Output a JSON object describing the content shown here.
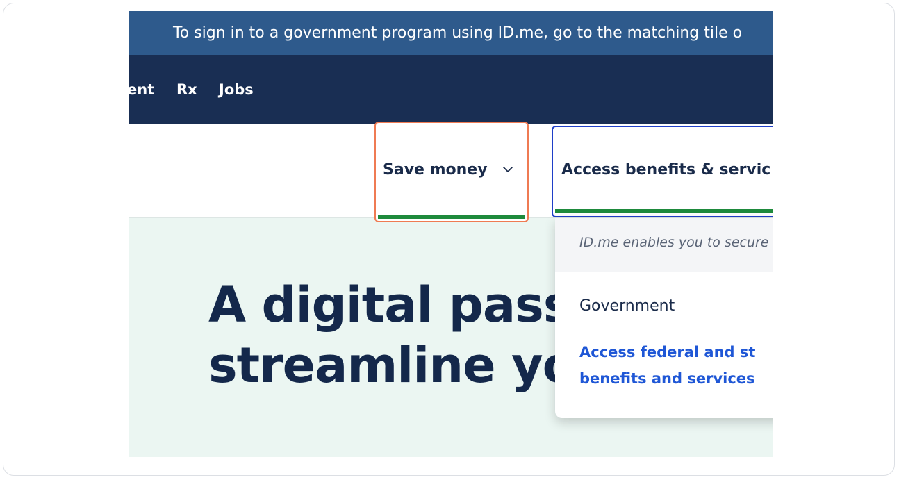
{
  "banner": {
    "text": "To sign in to a government program using ID.me, go to the matching tile o"
  },
  "nav": {
    "partial_item": "ent",
    "items": [
      "Rx",
      "Jobs"
    ]
  },
  "menu": {
    "save_money": {
      "label": "Save money",
      "icon": "chevron-down-icon"
    },
    "access_benefits": {
      "label": "Access benefits & servic"
    }
  },
  "hero": {
    "line1": "A digital pass",
    "line2": "streamline yo"
  },
  "dropdown": {
    "intro": "ID.me enables you to secure",
    "section_heading": "Government",
    "link_line1": "Access federal and st",
    "link_line2": "benefits and services"
  },
  "colors": {
    "banner_bg": "#2e5a8c",
    "nav_bg": "#192e53",
    "focus_outline": "#ef7b53",
    "active_outline": "#1f3fc8",
    "underline": "#1e8a3c",
    "hero_bg": "#ebf6f2",
    "link": "#1f57d6"
  }
}
